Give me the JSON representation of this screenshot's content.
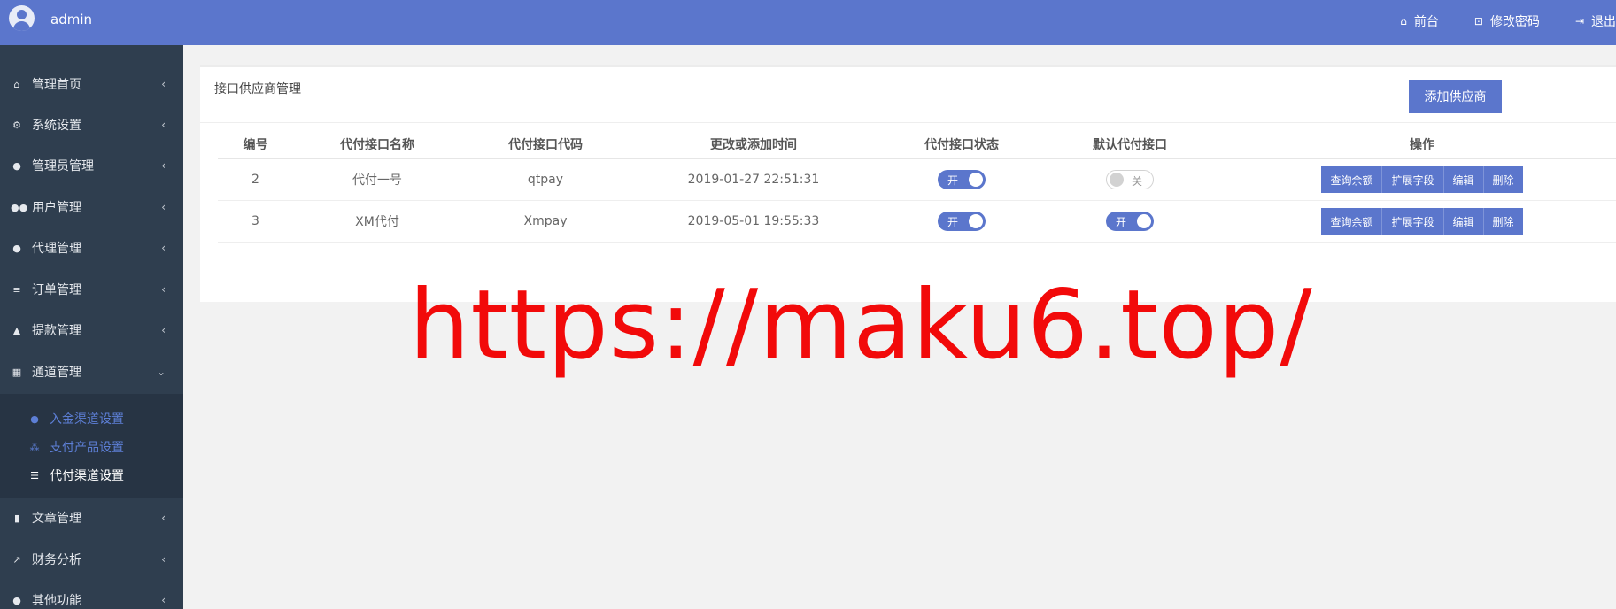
{
  "header": {
    "username": "admin",
    "links": [
      {
        "label": "前台",
        "icon": "home-icon"
      },
      {
        "label": "修改密码",
        "icon": "unlock-icon"
      },
      {
        "label": "退出",
        "icon": "logout-icon"
      }
    ]
  },
  "sidebar": {
    "items": [
      {
        "label": "管理首页",
        "icon": "home-icon"
      },
      {
        "label": "系统设置",
        "icon": "cogs-icon"
      },
      {
        "label": "管理员管理",
        "icon": "user-circle-icon"
      },
      {
        "label": "用户管理",
        "icon": "users-icon"
      },
      {
        "label": "代理管理",
        "icon": "user-circle-icon"
      },
      {
        "label": "订单管理",
        "icon": "list-icon"
      },
      {
        "label": "提款管理",
        "icon": "bank-bag-icon"
      },
      {
        "label": "通道管理",
        "icon": "bank-icon"
      },
      {
        "label": "文章管理",
        "icon": "book-icon"
      },
      {
        "label": "财务分析",
        "icon": "line-chart-icon"
      },
      {
        "label": "其他功能",
        "icon": "user-circle-icon"
      }
    ],
    "submenu": [
      {
        "label": "入金渠道设置",
        "icon": "paypal-icon"
      },
      {
        "label": "支付产品设置",
        "icon": "sitemap-icon"
      },
      {
        "label": "代付渠道设置",
        "icon": "sliders-icon"
      }
    ]
  },
  "panel": {
    "title": "接口供应商管理",
    "add_button": "添加供应商"
  },
  "table": {
    "headers": [
      "编号",
      "代付接口名称",
      "代付接口代码",
      "更改或添加时间",
      "代付接口状态",
      "默认代付接口",
      "操作"
    ],
    "rows": [
      {
        "id": "2",
        "name": "代付一号",
        "code": "qtpay",
        "time": "2019-01-27 22:51:31",
        "status": "开",
        "default": "关"
      },
      {
        "id": "3",
        "name": "XM代付",
        "code": "Xmpay",
        "time": "2019-05-01 19:55:33",
        "status": "开",
        "default": "开"
      }
    ],
    "actions": [
      "查询余额",
      "扩展字段",
      "编辑",
      "删除"
    ]
  },
  "watermark": "https://maku6.top/",
  "colors": {
    "primary": "#5b76cc",
    "sidebar": "#2f3e4f",
    "watermark": "#f20a0a"
  }
}
